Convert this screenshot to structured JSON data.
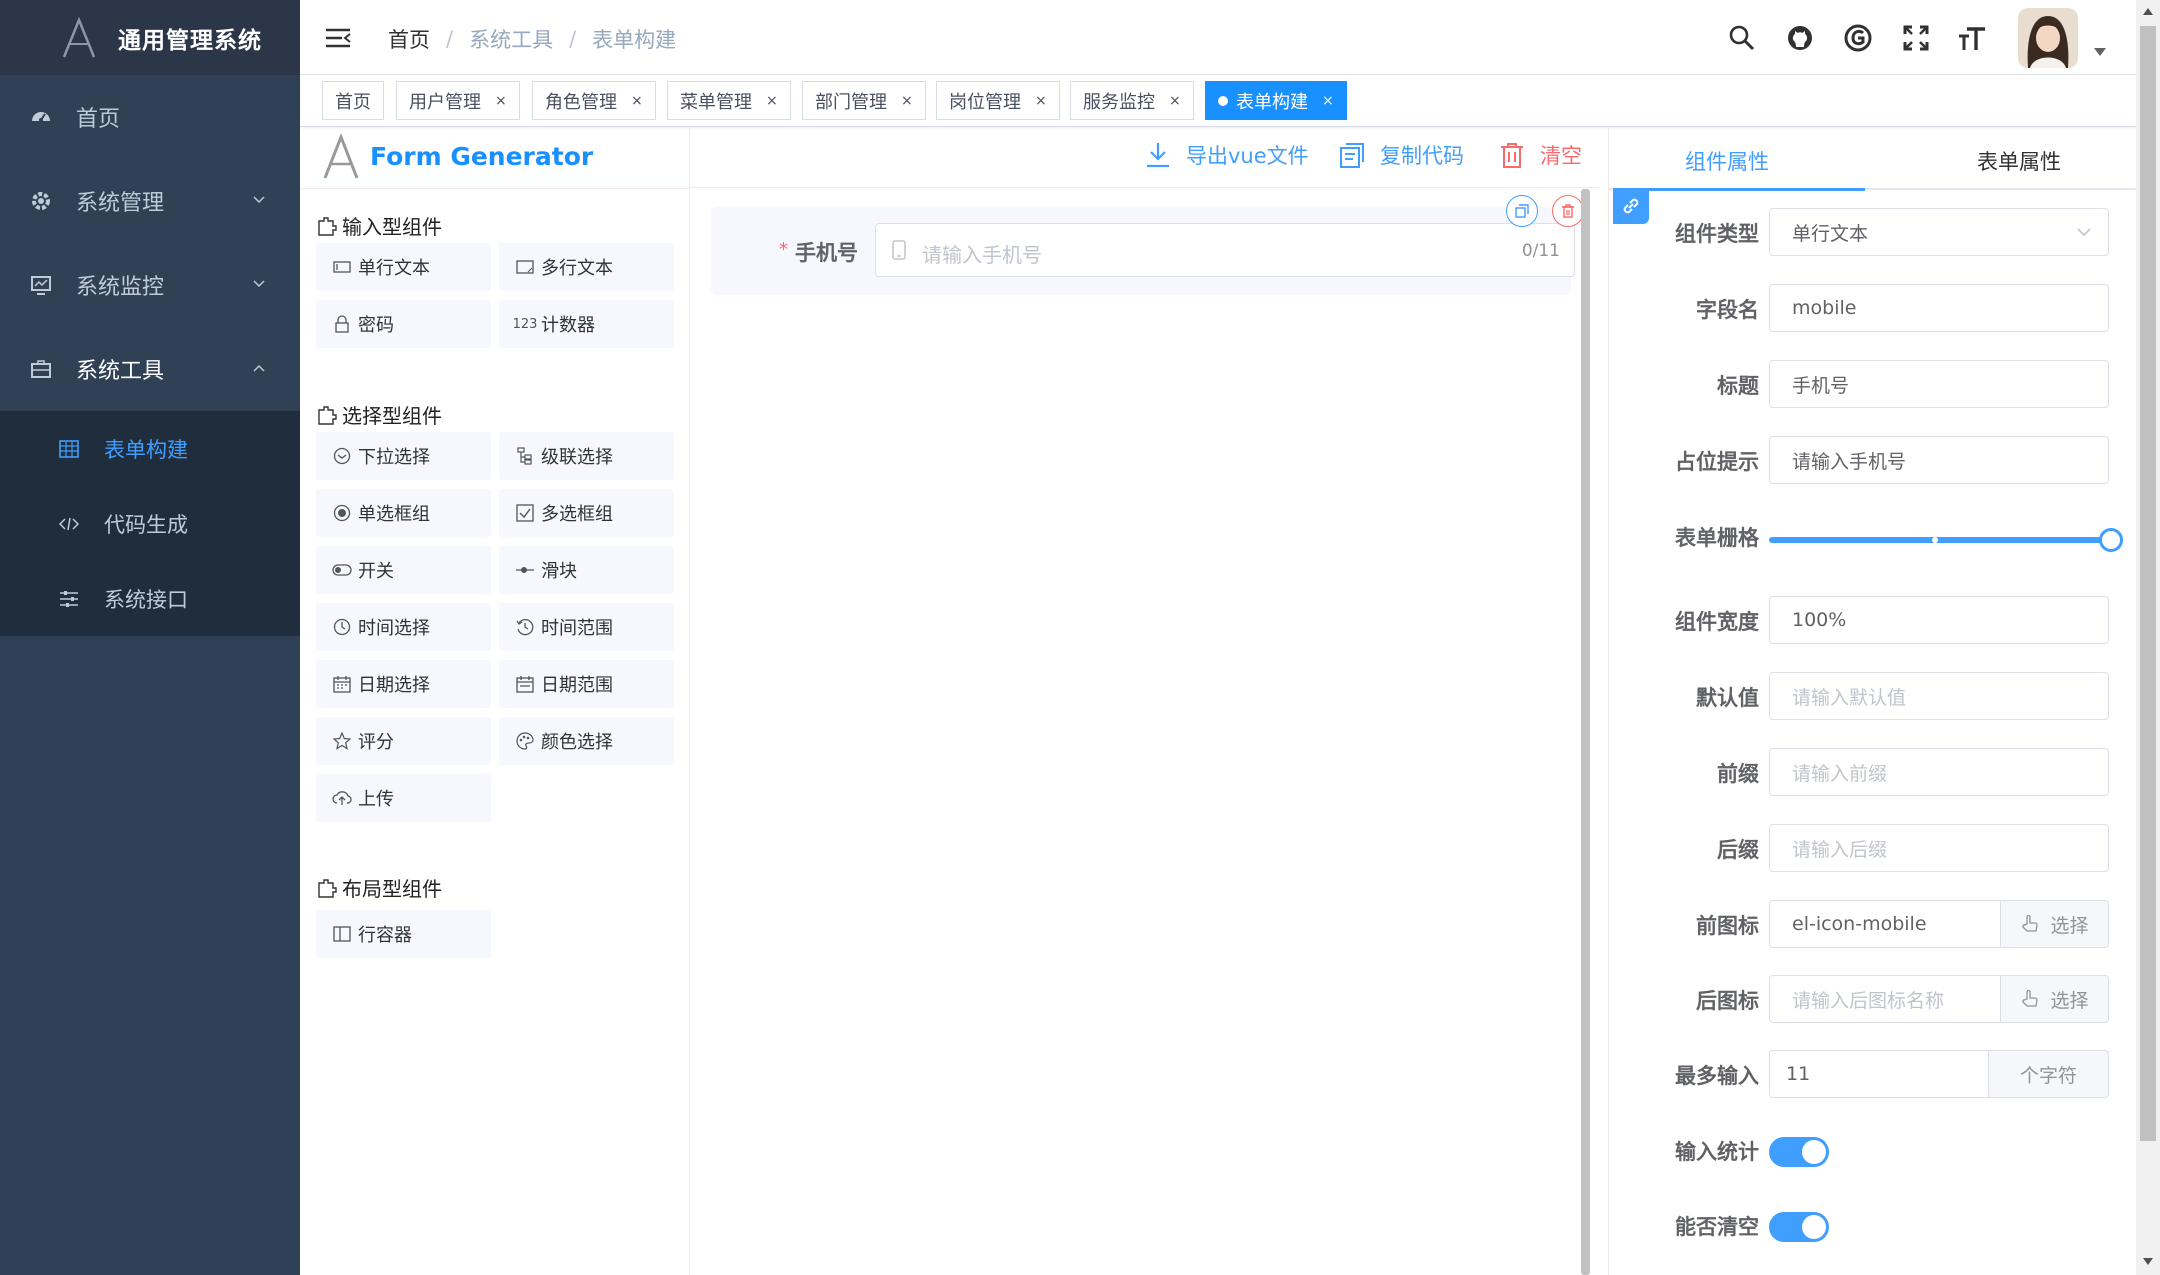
{
  "app": {
    "title": "通用管理系统"
  },
  "sidebar": {
    "items": [
      {
        "label": "首页",
        "icon": "dashboard-icon"
      },
      {
        "label": "系统管理",
        "icon": "gear-icon"
      },
      {
        "label": "系统监控",
        "icon": "monitor-icon"
      },
      {
        "label": "系统工具",
        "icon": "toolbox-icon"
      }
    ],
    "subitems": [
      {
        "label": "表单构建",
        "icon": "table-icon"
      },
      {
        "label": "代码生成",
        "icon": "code-icon"
      },
      {
        "label": "系统接口",
        "icon": "sliders-icon"
      }
    ]
  },
  "navbar": {
    "breadcrumb": [
      "首页",
      "系统工具",
      "表单构建"
    ],
    "icons": [
      "search-icon",
      "github-icon",
      "doc-icon",
      "fullscreen-icon",
      "font-size-icon"
    ]
  },
  "tags": [
    {
      "label": "首页"
    },
    {
      "label": "用户管理"
    },
    {
      "label": "角色管理"
    },
    {
      "label": "菜单管理"
    },
    {
      "label": "部门管理"
    },
    {
      "label": "岗位管理"
    },
    {
      "label": "服务监控"
    },
    {
      "label": "表单构建"
    }
  ],
  "generator": {
    "title": "Form Generator",
    "groups": [
      {
        "title": "输入型组件",
        "items": [
          "单行文本",
          "多行文本",
          "密码",
          "计数器"
        ]
      },
      {
        "title": "选择型组件",
        "items": [
          "下拉选择",
          "级联选择",
          "单选框组",
          "多选框组",
          "开关",
          "滑块",
          "时间选择",
          "时间范围",
          "日期选择",
          "日期范围",
          "评分",
          "颜色选择",
          "上传"
        ]
      },
      {
        "title": "布局型组件",
        "items": [
          "行容器"
        ]
      }
    ],
    "counter_glyph": "123"
  },
  "actions": {
    "export": "导出vue文件",
    "copy": "复制代码",
    "clear": "清空"
  },
  "canvas": {
    "field": {
      "label": "手机号",
      "placeholder": "请输入手机号",
      "count": "0/11"
    }
  },
  "props": {
    "tabs": [
      "组件属性",
      "表单属性"
    ],
    "component_type": {
      "label": "组件类型",
      "value": "单行文本"
    },
    "field_name": {
      "label": "字段名",
      "value": "mobile"
    },
    "title": {
      "label": "标题",
      "value": "手机号"
    },
    "placeholder": {
      "label": "占位提示",
      "value": "请输入手机号"
    },
    "span": {
      "label": "表单栅格",
      "value": 24,
      "max": 24
    },
    "width": {
      "label": "组件宽度",
      "value": "100%"
    },
    "default": {
      "label": "默认值",
      "placeholder": "请输入默认值"
    },
    "prefix": {
      "label": "前缀",
      "placeholder": "请输入前缀"
    },
    "suffix": {
      "label": "后缀",
      "placeholder": "请输入后缀"
    },
    "prefix_icon": {
      "label": "前图标",
      "value": "el-icon-mobile",
      "button": "选择"
    },
    "suffix_icon": {
      "label": "后图标",
      "placeholder": "请输入后图标名称",
      "button": "选择"
    },
    "maxlength": {
      "label": "最多输入",
      "value": "11",
      "append": "个字符"
    },
    "show_word_limit": {
      "label": "输入统计",
      "on": true
    },
    "clearable": {
      "label": "能否清空",
      "on": true
    }
  },
  "colors": {
    "sidebar_bg": "#304156",
    "accent": "#409eff",
    "danger": "#f56c6c",
    "tag_active": "#1890ff"
  }
}
